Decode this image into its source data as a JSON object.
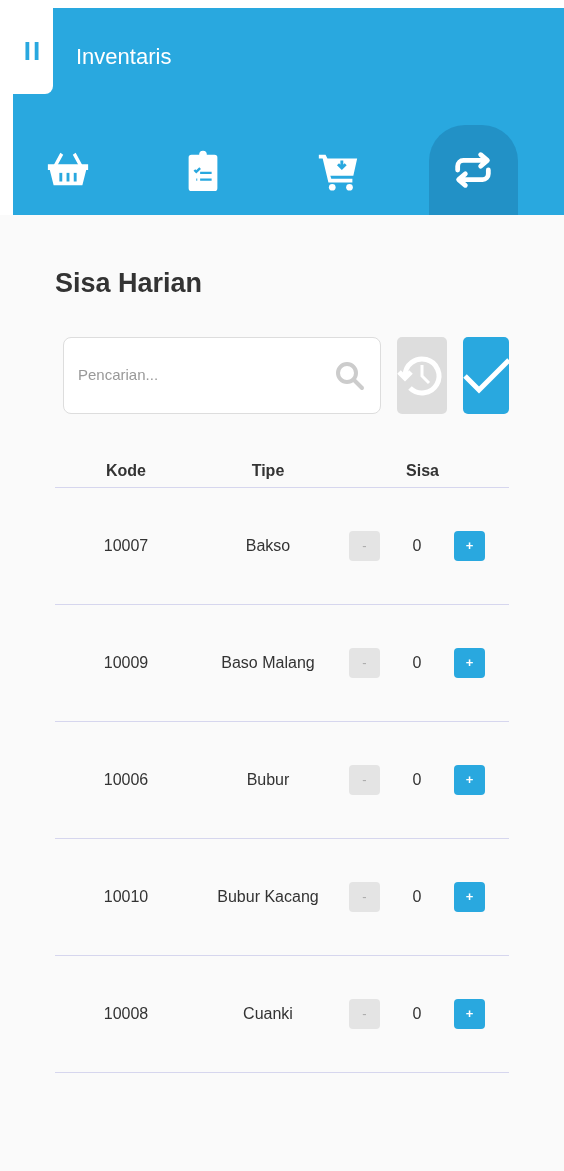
{
  "header": {
    "menu_icon": "II",
    "title": "Inventaris"
  },
  "tabs": [
    {
      "kind": "basket",
      "selected": false
    },
    {
      "kind": "clipboard",
      "selected": false
    },
    {
      "kind": "cart",
      "selected": false
    },
    {
      "kind": "swap",
      "selected": true
    }
  ],
  "page_title": "Sisa Harian",
  "search": {
    "placeholder": "Pencarian..."
  },
  "table": {
    "columns": [
      "Kode",
      "Tipe",
      "Sisa"
    ],
    "rows": [
      {
        "code": "10007",
        "type": "Bakso",
        "minus": "-",
        "qty": "0",
        "plus": "+"
      },
      {
        "code": "10009",
        "type": "Baso Malang",
        "minus": "-",
        "qty": "0",
        "plus": "+"
      },
      {
        "code": "10006",
        "type": "Bubur",
        "minus": "-",
        "qty": "0",
        "plus": "+"
      },
      {
        "code": "10010",
        "type": "Bubur Kacang",
        "minus": "-",
        "qty": "0",
        "plus": "+"
      },
      {
        "code": "10008",
        "type": "Cuanki",
        "minus": "-",
        "qty": "0",
        "plus": "+"
      }
    ]
  }
}
